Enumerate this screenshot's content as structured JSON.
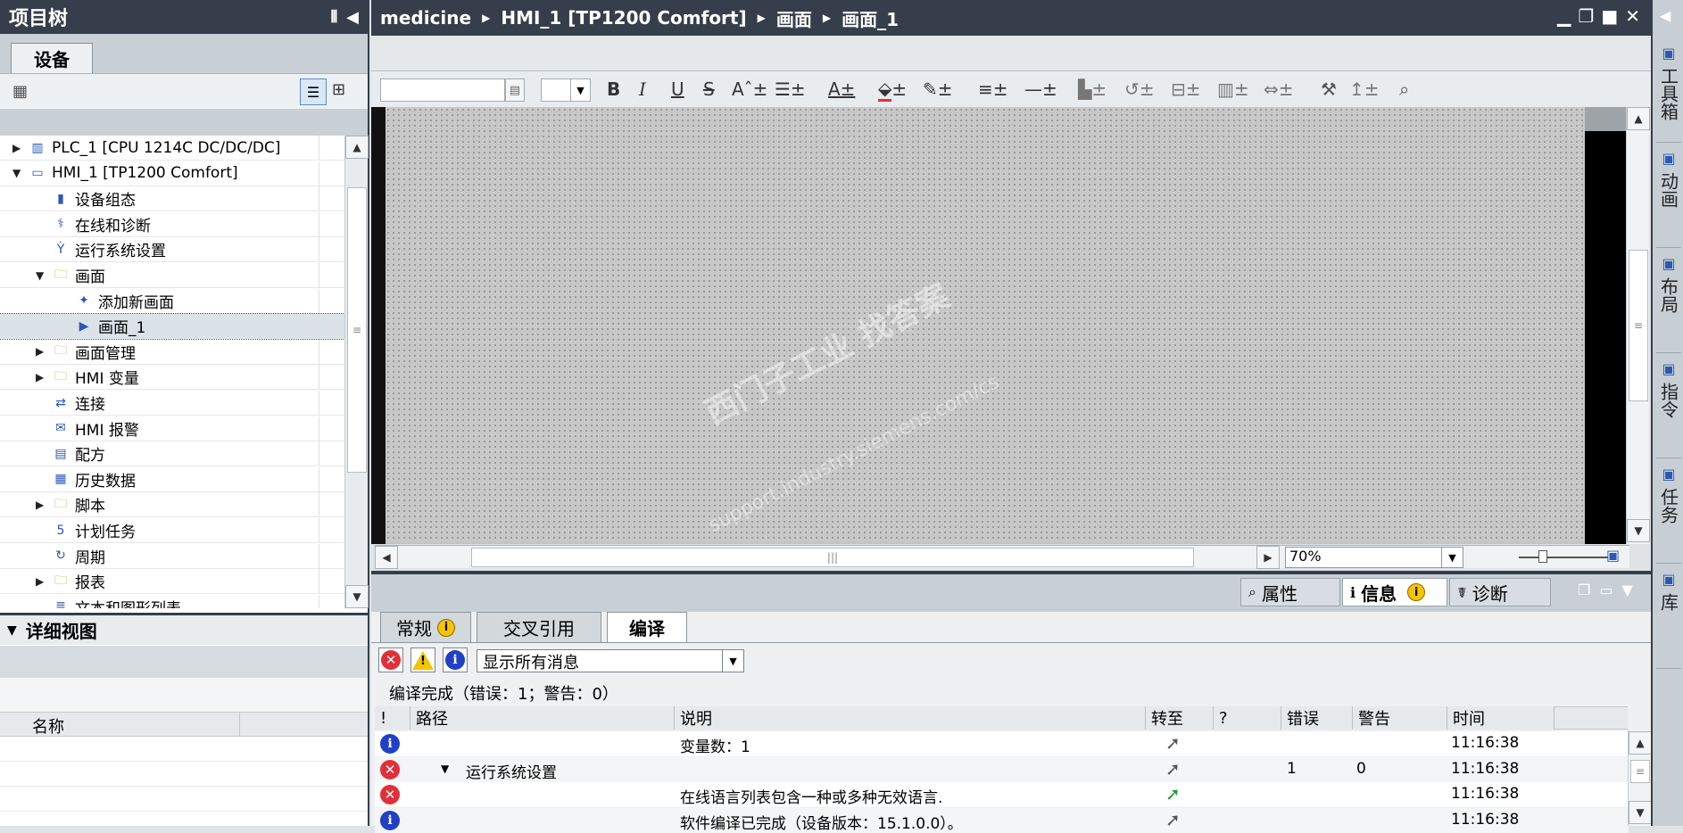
{
  "left": {
    "title": "项目树",
    "tab_devices": "设备",
    "tree": [
      {
        "label": "PLC_1 [CPU 1214C DC/DC/DC]",
        "level": 1,
        "arrow": "▶",
        "icon": "plc-icon"
      },
      {
        "label": "HMI_1 [TP1200 Comfort]",
        "level": 1,
        "arrow": "▼",
        "icon": "hmi-device-icon"
      },
      {
        "label": "设备组态",
        "level": 2,
        "arrow": "",
        "icon": "device-config-icon"
      },
      {
        "label": "在线和诊断",
        "level": 2,
        "arrow": "",
        "icon": "online-diagnostics-icon"
      },
      {
        "label": "运行系统设置",
        "level": 2,
        "arrow": "",
        "icon": "runtime-settings-icon"
      },
      {
        "label": "画面",
        "level": 2,
        "arrow": "▼",
        "icon": "folder-icon"
      },
      {
        "label": "添加新画面",
        "level": 3,
        "arrow": "",
        "icon": "add-screen-icon"
      },
      {
        "label": "画面_1",
        "level": 3,
        "arrow": "",
        "icon": "screen-icon",
        "selected": true
      },
      {
        "label": "画面管理",
        "level": 2,
        "arrow": "▶",
        "icon": "folder-icon"
      },
      {
        "label": "HMI 变量",
        "level": 2,
        "arrow": "▶",
        "icon": "folder-icon"
      },
      {
        "label": "连接",
        "level": 2,
        "arrow": "",
        "icon": "connection-icon"
      },
      {
        "label": "HMI 报警",
        "level": 2,
        "arrow": "",
        "icon": "alarm-icon"
      },
      {
        "label": "配方",
        "level": 2,
        "arrow": "",
        "icon": "recipe-icon"
      },
      {
        "label": "历史数据",
        "level": 2,
        "arrow": "",
        "icon": "historical-data-icon"
      },
      {
        "label": "脚本",
        "level": 2,
        "arrow": "▶",
        "icon": "folder-icon"
      },
      {
        "label": "计划任务",
        "level": 2,
        "arrow": "",
        "icon": "scheduled-task-icon"
      },
      {
        "label": "周期",
        "level": 2,
        "arrow": "",
        "icon": "cycle-icon"
      },
      {
        "label": "报表",
        "level": 2,
        "arrow": "▶",
        "icon": "folder-icon"
      },
      {
        "label": "文本和图形列表",
        "level": 2,
        "arrow": "",
        "icon": "text-graphic-list-icon"
      }
    ],
    "detail_title": "详细视图",
    "detail_col_name": "名称"
  },
  "breadcrumb": [
    "medicine",
    "HMI_1 [TP1200 Comfort]",
    "画面",
    "画面_1"
  ],
  "zoom": "70%",
  "panel_tabs": {
    "properties": "属性",
    "info": "信息",
    "diagnostics": "诊断"
  },
  "info_tabs": {
    "general": "常规",
    "crossref": "交叉引用",
    "compile": "编译"
  },
  "filter_value": "显示所有消息",
  "compile_summary": "编译完成（错误：1；警告：0）",
  "columns": {
    "bang": "!",
    "path": "路径",
    "desc": "说明",
    "goto": "转至",
    "q": "?",
    "errors": "错误",
    "warnings": "警告",
    "time": "时间"
  },
  "messages": [
    {
      "type": "info",
      "path": "",
      "desc": "变量数：1",
      "errors": "",
      "warnings": "",
      "time": "11:16:38",
      "goto_color": "#555555"
    },
    {
      "type": "error",
      "path": "运行系统设置",
      "desc": "",
      "errors": "1",
      "warnings": "0",
      "time": "11:16:38",
      "goto_color": "#555555"
    },
    {
      "type": "error",
      "path": "",
      "desc": "在线语言列表包含一种或多种无效语言.",
      "errors": "",
      "warnings": "",
      "time": "11:16:38",
      "goto_color": "#1e9a3c"
    },
    {
      "type": "info",
      "path": "",
      "desc": "软件编译已完成（设备版本：15.1.0.0）。",
      "errors": "",
      "warnings": "",
      "time": "11:16:38",
      "goto_color": "#555555"
    }
  ],
  "watermark": {
    "line1": "西门子工业 找答案",
    "line2": "support.industry.siemens.com/cs"
  },
  "right_tabs": [
    "工具箱",
    "动画",
    "布局",
    "指令",
    "任务",
    "库"
  ],
  "colors": {
    "header": "#353e4a",
    "canvas": "#c8c8c8",
    "error": "#e0303a",
    "info": "#2140c8",
    "warning": "#f4c400"
  }
}
